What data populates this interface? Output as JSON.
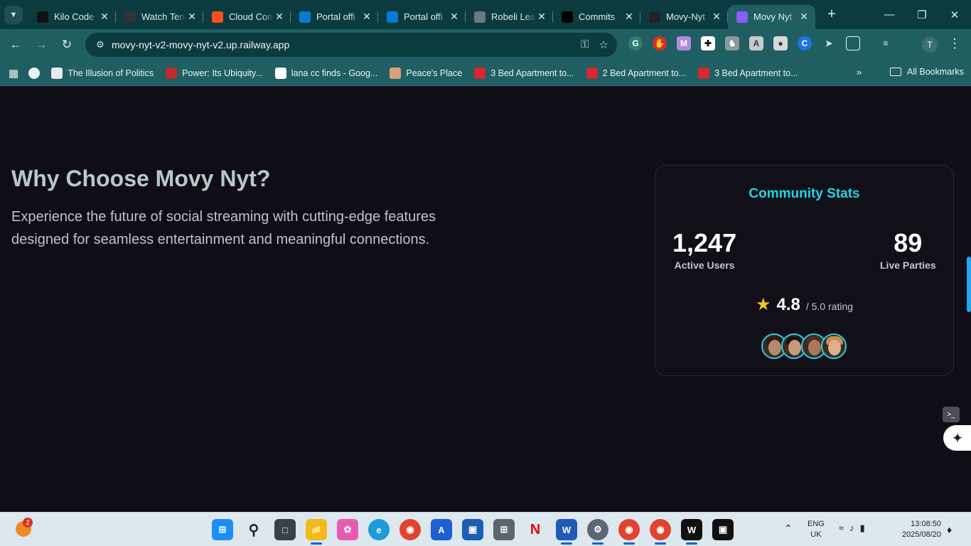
{
  "browser": {
    "tabs": [
      {
        "title": "Kilo Code",
        "favicon": "kilo-code-icon",
        "color": "#111111"
      },
      {
        "title": "Watch Ten",
        "favicon": "watch-icon",
        "color": "#333333"
      },
      {
        "title": "Cloud Con",
        "favicon": "microsoft-icon",
        "color": "#f25022"
      },
      {
        "title": "Portal offi",
        "favicon": "azure-icon",
        "color": "#0a7ad8"
      },
      {
        "title": "Portal offi",
        "favicon": "azure-icon",
        "color": "#0a7ad8"
      },
      {
        "title": "Robeli Lea",
        "favicon": "globe-icon",
        "color": "#6b7a7c"
      },
      {
        "title": "Commits",
        "favicon": "github-icon",
        "color": "#000000"
      },
      {
        "title": "Movy-Nyt",
        "favicon": "movy-icon",
        "color": "#222222"
      },
      {
        "title": "Movy Nyt",
        "favicon": "vite-icon",
        "color": "#8c5cf6",
        "active": true
      }
    ],
    "url": "movy-nyt-v2-movy-nyt-v2.up.railway.app",
    "profile_initial": "T",
    "bookmarks": [
      {
        "label": "The Illusion of Politics",
        "icon": "document-icon",
        "color": "#e9e9e9"
      },
      {
        "label": "Power: Its Ubiquity...",
        "icon": "book-icon",
        "color": "#c02b2b"
      },
      {
        "label": "lana cc finds - Goog...",
        "icon": "google-icon",
        "color": "#ffffff"
      },
      {
        "label": "Peace's Place",
        "icon": "photo-icon",
        "color": "#d8a07a"
      },
      {
        "label": "3 Bed Apartment to...",
        "icon": "property-icon",
        "color": "#d7272f"
      },
      {
        "label": "2 Bed Apartment to...",
        "icon": "property-icon",
        "color": "#d7272f"
      },
      {
        "label": "3 Bed Apartment to...",
        "icon": "property-icon",
        "color": "#d7272f"
      }
    ],
    "all_bookmarks": "All Bookmarks"
  },
  "page": {
    "headline": "Why Choose Movy Nyt?",
    "lede": "Experience the future of social streaming with cutting-edge features designed for seamless entertainment and meaningful connections.",
    "stats": {
      "title": "Community Stats",
      "active_users_value": "1,247",
      "active_users_label": "Active Users",
      "live_parties_value": "89",
      "live_parties_label": "Live Parties",
      "rating_value": "4.8",
      "rating_suffix": "/ 5.0 rating",
      "accent": "#1fd5e5",
      "star_color": "#f7c51c"
    }
  },
  "taskbar": {
    "weather_badge": "2",
    "lang_line1": "ENG",
    "lang_line2": "UK",
    "time": "13:08:50",
    "date": "2025/08/20"
  }
}
